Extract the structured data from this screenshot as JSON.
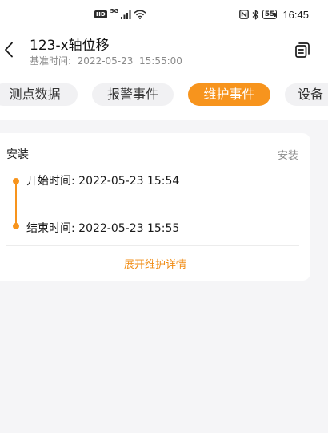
{
  "status_bar": {
    "hd_label": "HD",
    "network_label": "5G",
    "battery_level": "55",
    "time": "16:45"
  },
  "header": {
    "title": "123-x轴位移",
    "subtitle": "基准时间:  2022-05-23  15:55:00"
  },
  "tabs": [
    {
      "label": "测点数据",
      "active": false
    },
    {
      "label": "报警事件",
      "active": false
    },
    {
      "label": "维护事件",
      "active": true
    },
    {
      "label": "设备",
      "active": false
    }
  ],
  "event_card": {
    "title": "安装",
    "type_label": "安装",
    "start_time": "开始时间:  2022-05-23 15:54",
    "end_time": "结束时间:  2022-05-23 15:55",
    "expand_label": "展开维护详情"
  },
  "colors": {
    "accent": "#f7941d",
    "background": "#f5f5f7"
  }
}
